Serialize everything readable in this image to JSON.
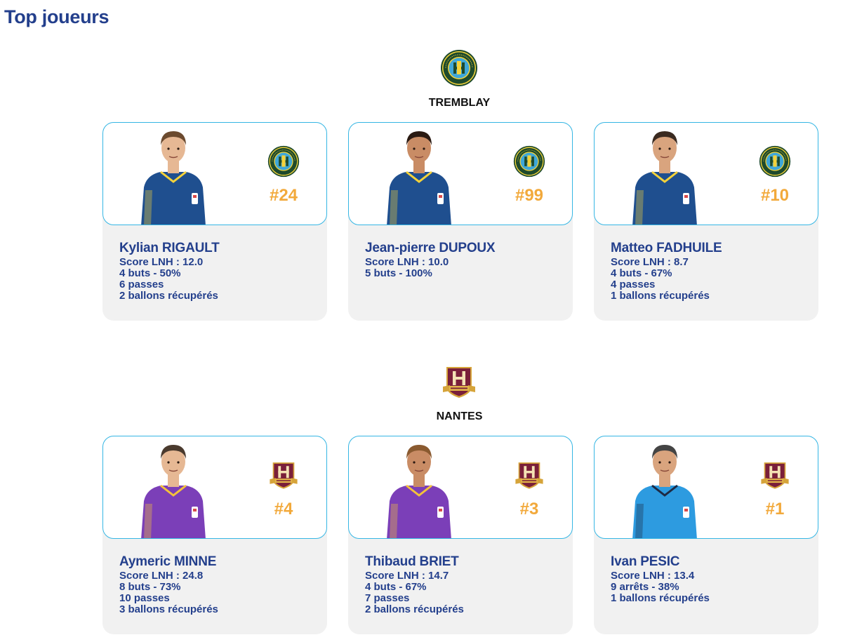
{
  "page": {
    "title": "Top joueurs"
  },
  "colors": {
    "title": "#233f8c",
    "number": "#f2a93b",
    "card_border": "#35b6e4",
    "card_bg": "#f1f1f1"
  },
  "teams": [
    {
      "name": "TREMBLAY",
      "logo": "tremblay-handball-crest-icon",
      "players": [
        {
          "name": "Kylian RIGAULT",
          "number": "#24",
          "stats": [
            "Score LNH : 12.0",
            "4 buts - 50%",
            "6 passes",
            "2 ballons récupérés"
          ]
        },
        {
          "name": "Jean-pierre DUPOUX",
          "number": "#99",
          "stats": [
            "Score LNH : 10.0",
            "5 buts - 100%"
          ]
        },
        {
          "name": "Matteo FADHUILE",
          "number": "#10",
          "stats": [
            "Score LNH : 8.7",
            "4 buts - 67%",
            "4 passes",
            "1 ballons récupérés"
          ]
        }
      ]
    },
    {
      "name": "NANTES",
      "logo": "hbc-nantes-crest-icon",
      "players": [
        {
          "name": "Aymeric MINNE",
          "number": "#4",
          "stats": [
            "Score LNH : 24.8",
            "8 buts - 73%",
            "10 passes",
            "3 ballons récupérés"
          ]
        },
        {
          "name": "Thibaud BRIET",
          "number": "#3",
          "stats": [
            "Score LNH : 14.7",
            "4 buts - 67%",
            "7 passes",
            "2 ballons récupérés"
          ]
        },
        {
          "name": "Ivan PESIC",
          "number": "#1",
          "stats": [
            "Score LNH : 13.4",
            "9 arrêts - 38%",
            "1 ballons récupérés"
          ]
        }
      ]
    }
  ]
}
